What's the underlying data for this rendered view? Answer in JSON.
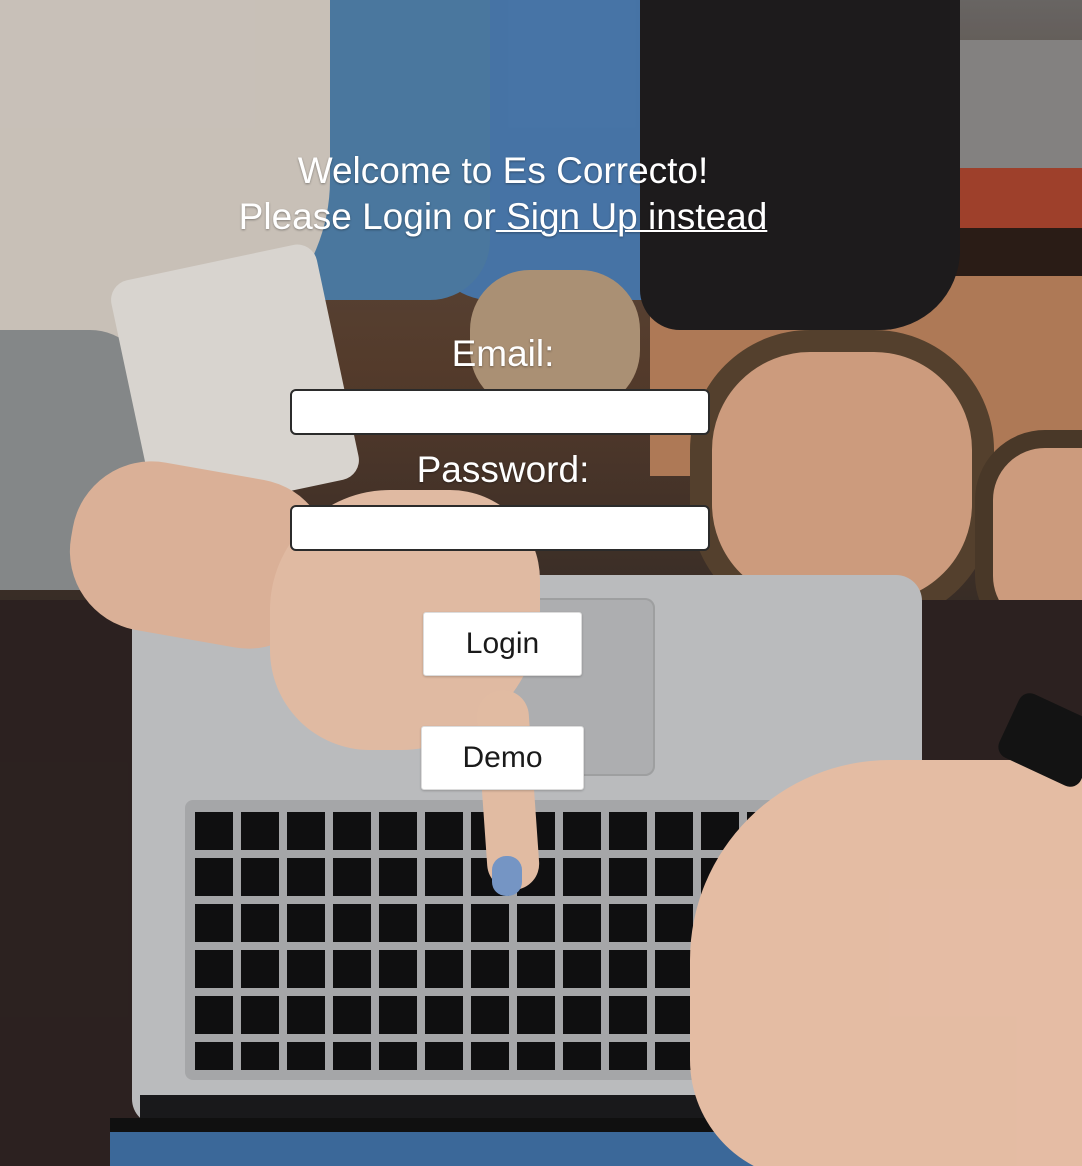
{
  "header": {
    "welcome": "Welcome to Es Correcto!",
    "prompt": "Please Login or",
    "signup_link": " Sign Up instead"
  },
  "form": {
    "email_label": "Email:",
    "email_value": "",
    "password_label": "Password:",
    "password_value": "",
    "login_button": "Login",
    "demo_button": "Demo"
  },
  "background": {
    "description_icon": "laptop-photo",
    "text_color": "#ffffff"
  }
}
